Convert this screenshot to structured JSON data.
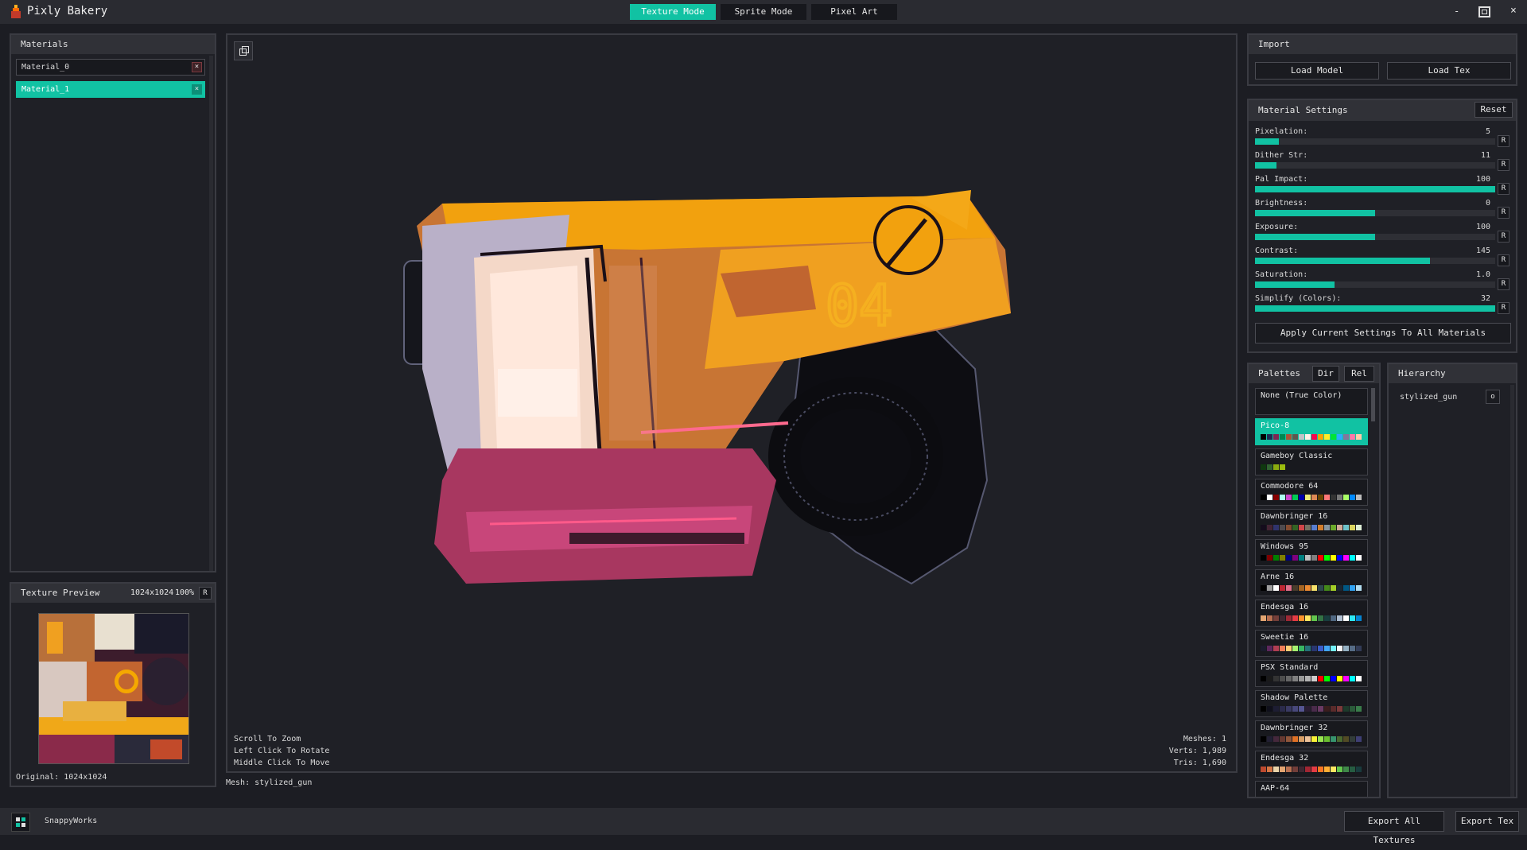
{
  "app": {
    "title": "Pixly Bakery",
    "window_controls": {
      "minimize": "-",
      "close": "×"
    }
  },
  "modes": [
    {
      "label": "Texture Mode",
      "active": true
    },
    {
      "label": "Sprite Mode",
      "active": false
    },
    {
      "label": "Pixel Art",
      "active": false
    }
  ],
  "materials": {
    "title": "Materials",
    "items": [
      {
        "label": "Material_0",
        "active": false
      },
      {
        "label": "Material_1",
        "active": true
      }
    ]
  },
  "texture_preview": {
    "title": "Texture Preview",
    "resolution": "1024x1024",
    "zoom": "100%",
    "reset_label": "R",
    "original": "Original: 1024x1024"
  },
  "viewport": {
    "hints": [
      "Scroll To Zoom",
      "Left Click To Rotate",
      "Middle Click To Move"
    ],
    "stats": [
      "Meshes: 1",
      "Verts: 1,989",
      "Tris: 1,690"
    ],
    "mesh_label": "Mesh: stylized_gun"
  },
  "import": {
    "title": "Import",
    "load_model": "Load Model",
    "load_tex": "Load Tex"
  },
  "material_settings": {
    "title": "Material Settings",
    "reset_label": "Reset",
    "sliders": [
      {
        "label": "Pixelation:",
        "value": "5",
        "fraction": 0.1
      },
      {
        "label": "Dither Str:",
        "value": "11",
        "fraction": 0.09
      },
      {
        "label": "Pal Impact:",
        "value": "100",
        "fraction": 1.0
      },
      {
        "label": "Brightness:",
        "value": "0",
        "fraction": 0.5
      },
      {
        "label": "Exposure:",
        "value": "100",
        "fraction": 0.5
      },
      {
        "label": "Contrast:",
        "value": "145",
        "fraction": 0.73
      },
      {
        "label": "Saturation:",
        "value": "1.0",
        "fraction": 0.33
      },
      {
        "label": "Simplify (Colors):",
        "value": "32",
        "fraction": 1.0
      }
    ],
    "slider_reset": "R",
    "apply_all": "Apply Current Settings To All Materials"
  },
  "palettes": {
    "title": "Palettes",
    "dir_label": "Dir",
    "rel_label": "Rel",
    "none_label": "None (True Color)",
    "items": [
      {
        "name": "Pico-8",
        "active": true,
        "colors": [
          "#000000",
          "#1d2b53",
          "#7e2553",
          "#008751",
          "#ab5236",
          "#5f574f",
          "#c2c3c7",
          "#fff1e8",
          "#ff004d",
          "#ffa300",
          "#ffec27",
          "#00e436",
          "#29adff",
          "#83769c",
          "#ff77a8",
          "#ffccaa"
        ]
      },
      {
        "name": "Gameboy Classic",
        "active": false,
        "colors": [
          "#0f380f",
          "#306230",
          "#8bac0f",
          "#9bbc0f"
        ]
      },
      {
        "name": "Commodore 64",
        "active": false,
        "colors": [
          "#000000",
          "#ffffff",
          "#880000",
          "#aaffee",
          "#cc44cc",
          "#00cc55",
          "#0000aa",
          "#eeee77",
          "#dd8855",
          "#664400",
          "#ff7777",
          "#333333",
          "#777777",
          "#aaff66",
          "#0088ff",
          "#bbbbbb"
        ]
      },
      {
        "name": "Dawnbringer 16",
        "active": false,
        "colors": [
          "#140c1c",
          "#442434",
          "#30346d",
          "#4e4a4e",
          "#854c30",
          "#346524",
          "#d04648",
          "#757161",
          "#597dce",
          "#d27d2c",
          "#8595a1",
          "#6daa2c",
          "#d2aa99",
          "#6dc2ca",
          "#dad45e",
          "#deeed6"
        ]
      },
      {
        "name": "Windows 95",
        "active": false,
        "colors": [
          "#000000",
          "#800000",
          "#008000",
          "#808000",
          "#000080",
          "#800080",
          "#008080",
          "#c0c0c0",
          "#808080",
          "#ff0000",
          "#00ff00",
          "#ffff00",
          "#0000ff",
          "#ff00ff",
          "#00ffff",
          "#ffffff"
        ]
      },
      {
        "name": "Arne 16",
        "active": false,
        "colors": [
          "#000000",
          "#9d9d9d",
          "#ffffff",
          "#be2633",
          "#e06f8b",
          "#493c2b",
          "#a46422",
          "#eb8931",
          "#f7e26b",
          "#2f484e",
          "#44891a",
          "#a3ce27",
          "#1b2632",
          "#005784",
          "#31a2f2",
          "#b2dcef"
        ]
      },
      {
        "name": "Endesga 16",
        "active": false,
        "colors": [
          "#e4a672",
          "#b86f50",
          "#743f39",
          "#3f2832",
          "#9e2835",
          "#e53b44",
          "#fb922b",
          "#ffe762",
          "#63c64d",
          "#327345",
          "#193d3f",
          "#4f6781",
          "#afbfd2",
          "#ffffff",
          "#2ce8f4",
          "#0484d1"
        ]
      },
      {
        "name": "Sweetie 16",
        "active": false,
        "colors": [
          "#1a1c2c",
          "#5d275d",
          "#b13e53",
          "#ef7d57",
          "#ffcd75",
          "#a7f070",
          "#38b764",
          "#257179",
          "#29366f",
          "#3b5dc9",
          "#41a6f6",
          "#73eff7",
          "#f4f4f4",
          "#94b0c2",
          "#566c86",
          "#333c57"
        ]
      },
      {
        "name": "PSX Standard",
        "active": false,
        "colors": [
          "#000000",
          "#1a1a1a",
          "#333333",
          "#4d4d4d",
          "#666666",
          "#808080",
          "#999999",
          "#b3b3b3",
          "#cccccc",
          "#ff0000",
          "#00ff00",
          "#0000ff",
          "#ffff00",
          "#ff00ff",
          "#00ffff",
          "#ffffff"
        ]
      },
      {
        "name": "Shadow Palette",
        "active": false,
        "colors": [
          "#000000",
          "#0f0f1b",
          "#1d1d33",
          "#2b2b4b",
          "#3a3a63",
          "#48487b",
          "#565693",
          "#2a1d33",
          "#4a2b4b",
          "#6a3a63",
          "#3a1d1d",
          "#5b2b2b",
          "#7c3a3a",
          "#1d3a2b",
          "#2b5b3a",
          "#3a7c4a"
        ]
      },
      {
        "name": "Dawnbringer 32",
        "active": false,
        "colors": [
          "#000000",
          "#222034",
          "#45283c",
          "#663931",
          "#8f563b",
          "#df7126",
          "#d9a066",
          "#eec39a",
          "#fbf236",
          "#99e550",
          "#6abe30",
          "#37946e",
          "#4b692f",
          "#524b24",
          "#323c39",
          "#3f3f74"
        ]
      },
      {
        "name": "Endesga 32",
        "active": false,
        "colors": [
          "#be4a2f",
          "#d77643",
          "#ead4aa",
          "#e4a672",
          "#b86f50",
          "#733e39",
          "#3e2731",
          "#a22633",
          "#e43b44",
          "#f77622",
          "#feae34",
          "#fee761",
          "#63c74d",
          "#3e8948",
          "#265c42",
          "#193c3e"
        ]
      },
      {
        "name": "AAP-64",
        "active": false,
        "colors": []
      }
    ]
  },
  "hierarchy": {
    "title": "Hierarchy",
    "items": [
      {
        "label": "stylized_gun",
        "toggle": "o"
      }
    ]
  },
  "footer": {
    "brand": "SnappyWorks",
    "export_all": "Export All Textures",
    "export_tex": "Export Tex"
  }
}
